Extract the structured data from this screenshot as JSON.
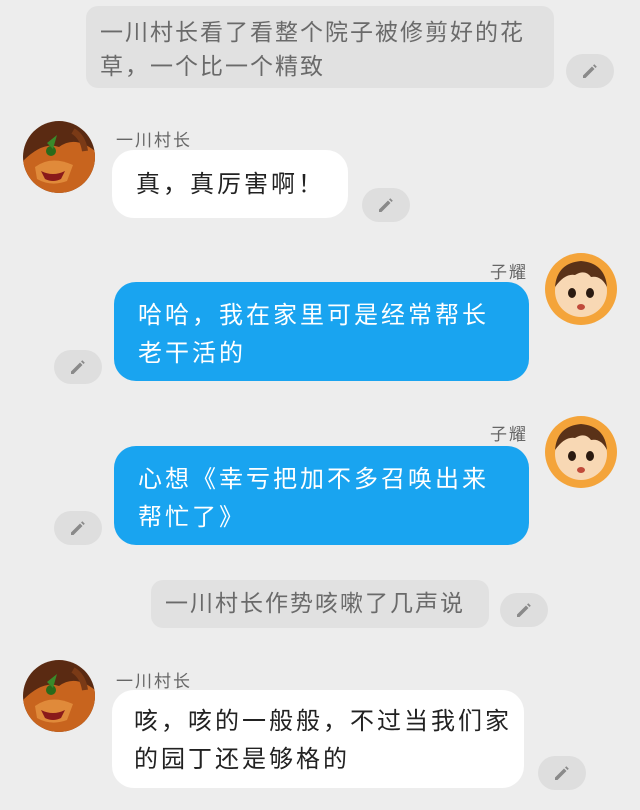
{
  "messages": [
    {
      "type": "narration",
      "text": "一川村长看了看整个院子被修剪好的花草，一个比一个精致"
    },
    {
      "type": "left",
      "speaker": "一川村长",
      "text": "真，真厉害啊！"
    },
    {
      "type": "right",
      "speaker": "子耀",
      "text": "哈哈，我在家里可是经常帮长老干活的"
    },
    {
      "type": "right",
      "speaker": "子耀",
      "text": "心想《幸亏把加不多召唤出来帮忙了》"
    },
    {
      "type": "narration",
      "text": "一川村长作势咳嗽了几声说"
    },
    {
      "type": "left",
      "speaker": "一川村长",
      "text": "咳，咳的一般般，不过当我们家的园丁还是够格的"
    }
  ],
  "icons": {
    "edit": "pencil-icon",
    "avatar_village_chief": "village-chief-avatar",
    "avatar_ziyao": "ziyao-avatar"
  },
  "colors": {
    "background": "#ededed",
    "narration_bg": "#e1e1e1",
    "left_bubble": "#ffffff",
    "right_bubble": "#19a4f0",
    "edit_button": "#dedede"
  }
}
